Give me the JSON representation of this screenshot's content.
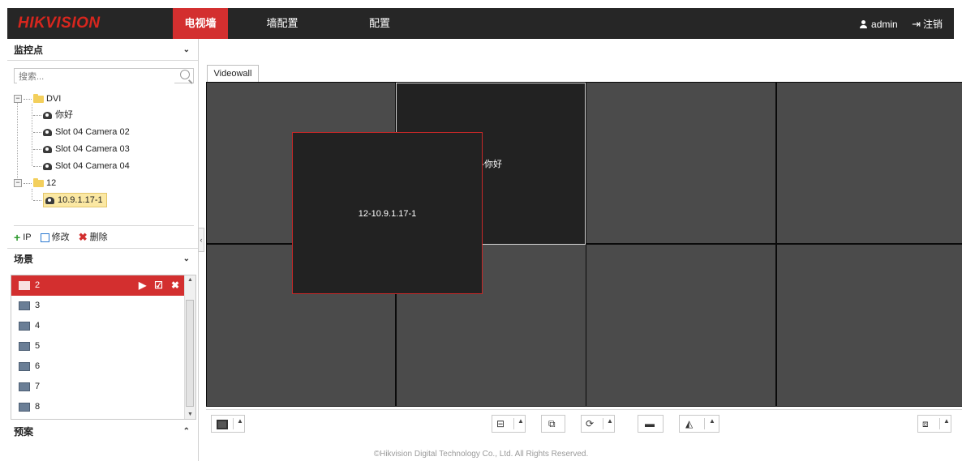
{
  "header": {
    "logo": "HIKVISION",
    "nav": [
      "电视墙",
      "墙配置",
      "配置"
    ],
    "active_nav": 0,
    "user": "admin",
    "logout": "注销"
  },
  "sidebar": {
    "monitor_title": "监控点",
    "search_placeholder": "搜索...",
    "tree": {
      "group1": "DVI",
      "group1_items": [
        "你好",
        "Slot 04 Camera 02",
        "Slot 04 Camera 03",
        "Slot 04 Camera 04"
      ],
      "group2": "12",
      "group2_items": [
        "10.9.1.17-1"
      ]
    },
    "actions": {
      "add": "IP",
      "edit": "修改",
      "delete": "删除"
    },
    "scene_title": "场景",
    "scenes": [
      "2",
      "3",
      "4",
      "5",
      "6",
      "7",
      "8"
    ],
    "plan_title": "预案"
  },
  "main": {
    "tab": "Videowall",
    "cell_label": "VI-你好",
    "window_label": "12-10.9.1.17-1"
  },
  "footer": "©Hikvision Digital Technology Co., Ltd. All Rights Reserved.",
  "colors": {
    "accent": "#d32f2f",
    "topbar": "#262626",
    "cell": "#4b4b4b"
  }
}
